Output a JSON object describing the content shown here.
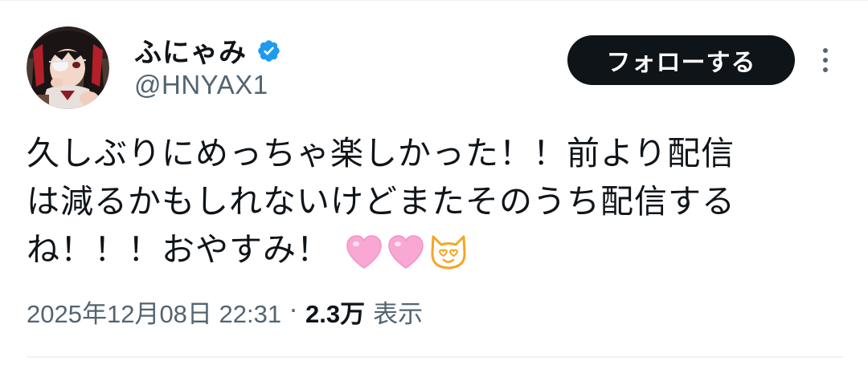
{
  "author": {
    "display_name": "ふにゃみ",
    "handle": "@HNYAX1",
    "verified": true,
    "verified_color": "#1d9bf0",
    "avatar_icon": "anime-girl-avatar"
  },
  "follow_button": {
    "label": "フォローする"
  },
  "more_icon": "more-vertical-icon",
  "tweet": {
    "lines": [
      "久しぶりにめっちゃ楽しかった！！前より配信",
      "は減るかもしれないけどまたそのうち配信する",
      "ね！！！おやすみ！"
    ],
    "emojis": [
      "pink-heart-icon",
      "pink-heart-icon",
      "heart-eyes-cat-icon"
    ]
  },
  "meta": {
    "timestamp": "2025年12月08日 22:31",
    "separator": "·",
    "views_count": "2.3万",
    "views_label": "表示"
  },
  "colors": {
    "text": "#0f1419",
    "muted": "#536471",
    "button_bg": "#0f1419",
    "heart": "#f9a8d4",
    "cat": "#f5a623"
  }
}
